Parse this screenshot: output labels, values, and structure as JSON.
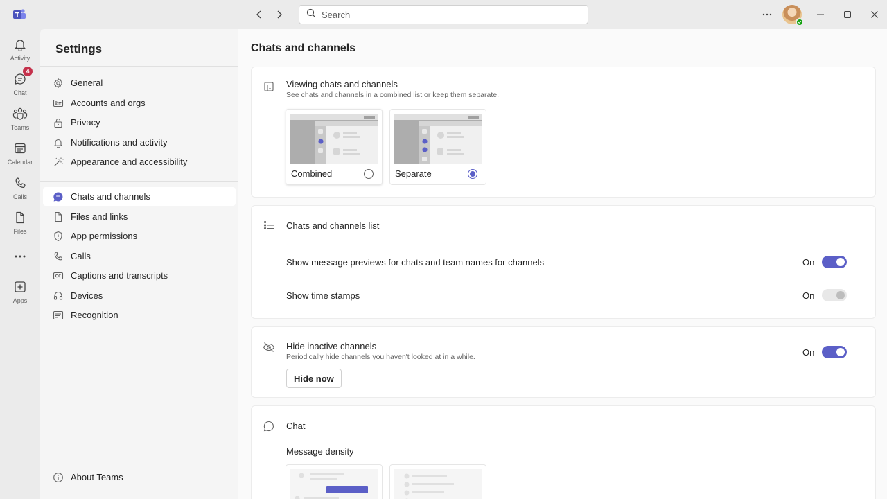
{
  "titlebar": {
    "search_placeholder": "Search"
  },
  "rail": {
    "items": [
      {
        "label": "Activity",
        "icon": "bell-icon"
      },
      {
        "label": "Chat",
        "icon": "chat-icon",
        "badge": "4"
      },
      {
        "label": "Teams",
        "icon": "teams-icon"
      },
      {
        "label": "Calendar",
        "icon": "calendar-icon"
      },
      {
        "label": "Calls",
        "icon": "phone-icon"
      },
      {
        "label": "Files",
        "icon": "file-icon"
      },
      {
        "label": "",
        "icon": "more-icon"
      },
      {
        "label": "Apps",
        "icon": "add-apps-icon"
      }
    ]
  },
  "settings": {
    "title": "Settings",
    "group1": [
      "General",
      "Accounts and orgs",
      "Privacy",
      "Notifications and activity",
      "Appearance and accessibility"
    ],
    "group2": [
      "Chats and channels",
      "Files and links",
      "App permissions",
      "Calls",
      "Captions and transcripts",
      "Devices",
      "Recognition"
    ],
    "active": "Chats and channels",
    "about": "About Teams"
  },
  "main": {
    "title": "Chats and channels",
    "viewing": {
      "title": "Viewing chats and channels",
      "subtitle": "See chats and channels in a combined list or keep them separate.",
      "options": [
        {
          "label": "Combined",
          "selected": false
        },
        {
          "label": "Separate",
          "selected": true
        }
      ]
    },
    "list": {
      "title": "Chats and channels list",
      "rows": [
        {
          "label": "Show message previews for chats and team names for channels",
          "state": "On",
          "enabled": true
        },
        {
          "label": "Show time stamps",
          "state": "On",
          "enabled": false
        }
      ]
    },
    "hide": {
      "title": "Hide inactive channels",
      "subtitle": "Periodically hide channels you haven't looked at in a while.",
      "state": "On",
      "button": "Hide now"
    },
    "chat": {
      "title": "Chat",
      "density_label": "Message density"
    }
  },
  "colors": {
    "accent": "#5b5fc7",
    "badge": "#c4314b",
    "presence": "#13a10e"
  }
}
